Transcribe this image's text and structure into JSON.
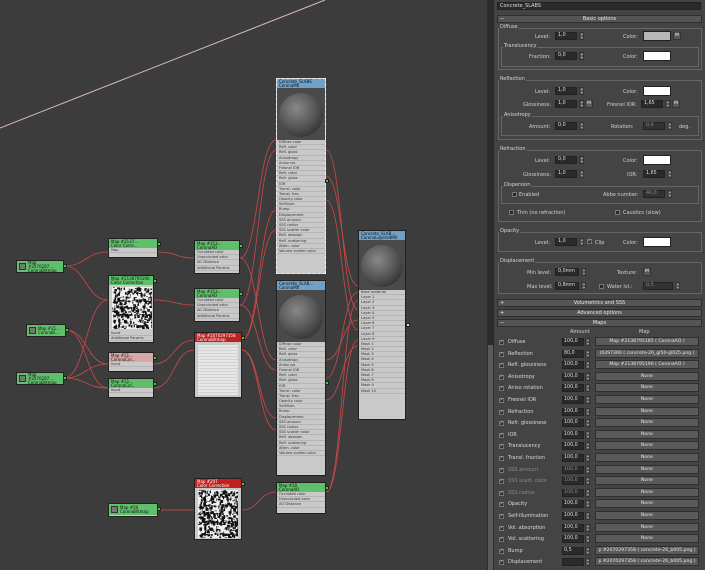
{
  "material_name": "Concrete_SLABS",
  "rollouts": {
    "basic": "Basic options",
    "volumetrics": "Volumetrics and SSS",
    "advanced": "Advanced options",
    "maps": "Maps"
  },
  "diffuse": {
    "title": "Diffuse",
    "level_label": "Level:",
    "level": "1,0",
    "color_label": "Color:",
    "m": "M",
    "translucency_title": "Translucency",
    "fraction_label": "Fraction:",
    "fraction": "0,0",
    "color2_label": "Color:"
  },
  "reflection": {
    "title": "Reflection",
    "level_label": "Level:",
    "level": "1,0",
    "color_label": "Color:",
    "gloss_label": "Glossiness:",
    "gloss": "1,0",
    "m": "M",
    "fresnel_label": "Fresnel IOR:",
    "fresnel": "1,65",
    "aniso_title": "Anisotropy",
    "amount_label": "Amount:",
    "amount": "0,0",
    "rotation_label": "Rotation:",
    "rotation": "0,0",
    "deg": "deg."
  },
  "refraction": {
    "title": "Refraction",
    "level_label": "Level:",
    "level": "0,0",
    "color_label": "Color:",
    "gloss_label": "Glossiness:",
    "gloss": "1,0",
    "ior_label": "IOR:",
    "ior": "1,65",
    "dispersion_title": "Dispersion",
    "enabled_label": "Enabled",
    "abbe_label": "Abbe number:",
    "abbe": "40,0",
    "thin_label": "Thin (no refraction)",
    "caustics_label": "Caustics (slow)"
  },
  "opacity": {
    "title": "Opacity",
    "level_label": "Level:",
    "level": "1,0",
    "clip_label": "Clip",
    "color_label": "Color:"
  },
  "displacement": {
    "title": "Displacement",
    "min_label": "Min level:",
    "min": "0,0mm",
    "texture_label": "Texture:",
    "m": "M",
    "max_label": "Max level:",
    "max": "0,8mm",
    "water_label": "Water lvl.:",
    "water": "0,5"
  },
  "maps": {
    "col_amount": "Amount",
    "col_map": "Map",
    "rows": [
      {
        "name": "Diffuse",
        "checked": true,
        "amount": "100,0",
        "map": "Map #2138795185 ( CoronaAO )",
        "dim": false
      },
      {
        "name": "Reflection",
        "checked": true,
        "amount": "80,0",
        "map": "(0297360 ( concrete-26_gl50-gl025.png )",
        "dim": false
      },
      {
        "name": "Refl. glossiness",
        "checked": true,
        "amount": "100,0",
        "map": "Map #2138795190 ( CoronaAO )",
        "dim": false
      },
      {
        "name": "Anisotropy",
        "checked": true,
        "amount": "100,0",
        "map": "None",
        "dim": false
      },
      {
        "name": "Aniso rotation",
        "checked": true,
        "amount": "100,0",
        "map": "None",
        "dim": false
      },
      {
        "name": "Fresnel IOR",
        "checked": true,
        "amount": "100,0",
        "map": "None",
        "dim": false
      },
      {
        "name": "Refraction",
        "checked": true,
        "amount": "100,0",
        "map": "None",
        "dim": false
      },
      {
        "name": "Refr. glossiness",
        "checked": true,
        "amount": "100,0",
        "map": "None",
        "dim": false
      },
      {
        "name": "IOR",
        "checked": true,
        "amount": "100,0",
        "map": "None",
        "dim": false
      },
      {
        "name": "Translucency",
        "checked": true,
        "amount": "100,0",
        "map": "None",
        "dim": false
      },
      {
        "name": "Transl. fraction",
        "checked": true,
        "amount": "100,0",
        "map": "None",
        "dim": false
      },
      {
        "name": "SSS amount",
        "checked": true,
        "amount": "100,0",
        "map": "None",
        "dim": true
      },
      {
        "name": "SSS scatt. color",
        "checked": true,
        "amount": "100,0",
        "map": "None",
        "dim": true
      },
      {
        "name": "SSS radius",
        "checked": true,
        "amount": "100,0",
        "map": "None",
        "dim": true
      },
      {
        "name": "Opacity",
        "checked": true,
        "amount": "100,0",
        "map": "None",
        "dim": false
      },
      {
        "name": "Self-illumination",
        "checked": true,
        "amount": "100,0",
        "map": "None",
        "dim": false
      },
      {
        "name": "Vol. absorption",
        "checked": true,
        "amount": "100,0",
        "map": "None",
        "dim": false
      },
      {
        "name": "Vol. scattering",
        "checked": true,
        "amount": "100,0",
        "map": "None",
        "dim": false
      },
      {
        "name": "Bump",
        "checked": true,
        "amount": "0,5",
        "map": "p #2070297358 ( concrete-26_b005.png )",
        "dim": false
      },
      {
        "name": "Displacement",
        "checked": true,
        "amount": "",
        "map": "p #2070297358 ( concrete-26_b005.png )",
        "dim": false
      }
    ]
  },
  "nodes": {
    "bitmap1": {
      "title": "Map #2070297...",
      "sub": "CoronaBitmap"
    },
    "cc1": {
      "title": "Map #2137...",
      "sub": "Color Corre..."
    },
    "ao1": {
      "title": "Map #213...",
      "sub": "CoronaAO"
    },
    "cc2": {
      "title": "Map #2138795190",
      "sub": "Color Correction"
    },
    "ao2": {
      "title": "Map #213...",
      "sub": "CoronaAO"
    },
    "bitmap2": {
      "title": "Map #21...",
      "sub": "CoronaB..."
    },
    "red1": {
      "title": "Map #2070297358",
      "sub": "CoronaBitmap"
    },
    "bitmap3": {
      "title": "Map #2070297...",
      "sub": "CoronaBitmap"
    },
    "cc3": {
      "title": "Map #21...",
      "sub": "CoronaCol..."
    },
    "cc4": {
      "title": "Map #21...",
      "sub": "CoronaCol..."
    },
    "mat1": {
      "title": "Concrete_SLABS",
      "sub": "CoronaMtl"
    },
    "mat2": {
      "title": "Concrete_SLAB...",
      "sub": "CoronaMtl"
    },
    "layered": {
      "title": "Concrete_SLAB...",
      "sub": "CoronaLayeredMtl"
    },
    "red2": {
      "title": "Map #207",
      "sub": "Color Correction"
    },
    "bitmap4": {
      "title": "Map #20",
      "sub": "CoronaBitmap"
    },
    "ao3": {
      "title": "Map #20",
      "sub": "CoronaAO"
    }
  },
  "slots": {
    "cc": [
      "Map"
    ],
    "ao": [
      "Occluded color",
      "Unoccluded color",
      "AO Distance",
      "Additional Params"
    ],
    "ccbig": [
      "Input",
      "Additional Params"
    ],
    "mtl": [
      "Diffuse color",
      "Refl. color",
      "Refl. gloss",
      "Anisotropy",
      "Aniso rot.",
      "Fresnel IOR",
      "Refr. color",
      "Refr. gloss",
      "IOR",
      "Transl. color",
      "Transl. frac.",
      "Opacity color",
      "Selfillum",
      "Bump",
      "Displacement",
      "SSS amount",
      "SSS radius",
      "SSS scatter color",
      "Refl. absorpt.",
      "Refl. scattering",
      "Atten. color",
      "Volume scatter color"
    ],
    "layered": [
      "Base material",
      "Layer 1",
      "Layer 2",
      "Layer 3",
      "Layer 4",
      "Layer 5",
      "Layer 6",
      "Layer 7",
      "Layer 8",
      "Layer 9",
      "Mask 1",
      "Mask 2",
      "Mask 3",
      "Mask 4",
      "Mask 5",
      "Mask 6",
      "Mask 7",
      "Mask 8",
      "Mask 9",
      "Mask 10"
    ]
  },
  "colors": {
    "node_header": "#5fbf6a",
    "red_header": "#c02020",
    "wire": "#d04848",
    "panel_bg": "#444444",
    "swatch_diffuse": "#b8b8b8",
    "swatch_white": "#ffffff"
  }
}
